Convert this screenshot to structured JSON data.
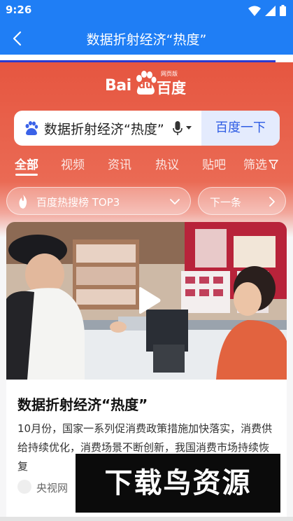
{
  "status_bar": {
    "time": "9:26",
    "icons": [
      "wifi-icon",
      "signal-icon",
      "battery-icon"
    ]
  },
  "app_bar": {
    "title": "数据折射经济“热度”",
    "back_icon": "back-arrow-icon"
  },
  "page_load_progress": 0.94,
  "baidu": {
    "logo_latin": "Bai",
    "logo_du": "du",
    "logo_cn": "百度",
    "logo_tag": "网页版",
    "search_query": "数据折射经济“热度”",
    "search_button": "百度一下"
  },
  "tabs": [
    {
      "label": "全部",
      "active": true
    },
    {
      "label": "视频",
      "active": false
    },
    {
      "label": "资讯",
      "active": false
    },
    {
      "label": "热议",
      "active": false
    },
    {
      "label": "贴吧",
      "active": false
    },
    {
      "label": "筛选",
      "active": false,
      "icon": "filter-icon"
    }
  ],
  "hot_chip": {
    "label": "百度热搜榜 TOP3",
    "icon": "flame-icon"
  },
  "next_chip": {
    "label": "下一条",
    "icon": "chevron-right-icon"
  },
  "result_card": {
    "title": "数据折射经济“热度”",
    "summary": "10月份，国家一系列促消费政策措施加快落实，消费供给持续优化，消费场景不断创新，我国消费市场持续恢复",
    "source": "央视网"
  },
  "watermark": "下载鸟资源",
  "colors": {
    "app_bar": "#1f7ef5",
    "baidu_red": "#e65640",
    "search_button_bg": "#e4ebfd",
    "search_button_text": "#2e5ce4"
  }
}
